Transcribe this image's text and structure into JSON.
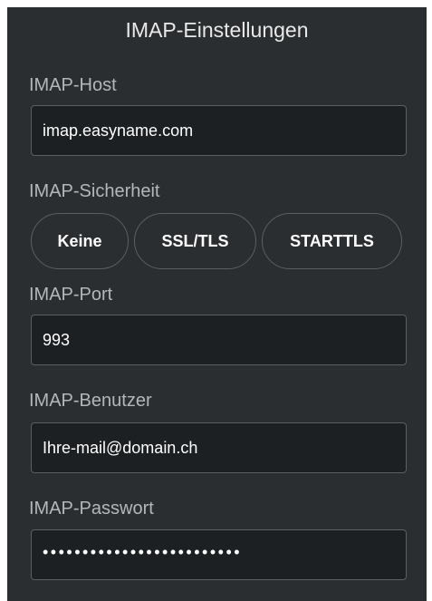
{
  "panel": {
    "title": "IMAP-Einstellungen"
  },
  "host": {
    "label": "IMAP-Host",
    "value": "imap.easyname.com"
  },
  "security": {
    "label": "IMAP-Sicherheit",
    "options": [
      {
        "label": "Keine"
      },
      {
        "label": "SSL/TLS"
      },
      {
        "label": "STARTTLS"
      }
    ]
  },
  "port": {
    "label": "IMAP-Port",
    "value": "993"
  },
  "user": {
    "label": "IMAP-Benutzer",
    "value": "Ihre-mail@domain.ch"
  },
  "password": {
    "label": "IMAP-Passwort",
    "masked_value": "•••••••••••••••••••••••••"
  }
}
